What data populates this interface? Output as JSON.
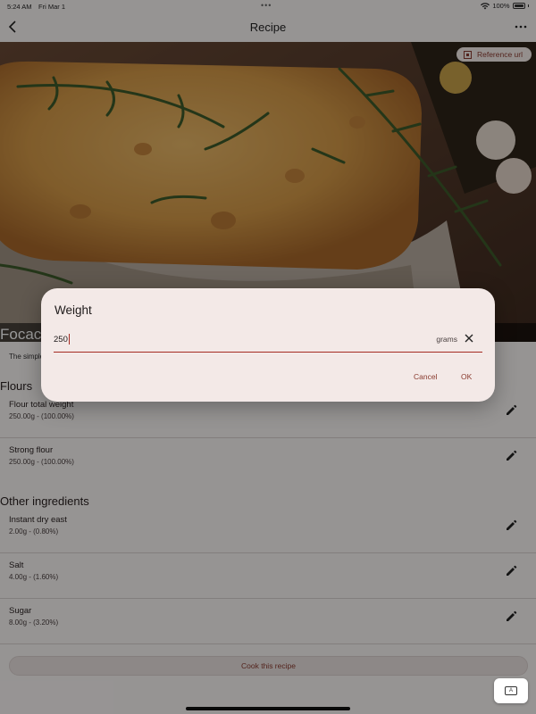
{
  "status_bar": {
    "time": "5:24 AM",
    "date": "Fri Mar 1",
    "battery": "100%"
  },
  "app_bar": {
    "title": "Recipe"
  },
  "hero": {
    "reference_url_label": "Reference url"
  },
  "recipe": {
    "title": "Focaccia",
    "description": "The simple and delicious focaccia bread recipe"
  },
  "sections": {
    "flours": {
      "title": "Flours",
      "items": [
        {
          "name": "Flour total weight",
          "amount": "250.00g - (100.00%)"
        },
        {
          "name": "Strong flour",
          "amount": "250.00g - (100.00%)"
        }
      ]
    },
    "other": {
      "title": "Other ingredients",
      "items": [
        {
          "name": "Instant dry east",
          "amount": "2.00g - (0.80%)"
        },
        {
          "name": "Salt",
          "amount": "4.00g - (1.60%)"
        },
        {
          "name": "Sugar",
          "amount": "8.00g - (3.20%)"
        }
      ]
    }
  },
  "cook_button": {
    "label": "Cook this recipe"
  },
  "dialog": {
    "title": "Weight",
    "input_value": "250",
    "unit": "grams",
    "cancel_label": "Cancel",
    "ok_label": "OK"
  },
  "colors": {
    "accent": "#8a3b2f",
    "underline": "#a52a22",
    "dialog_bg": "#f3e9e7"
  }
}
